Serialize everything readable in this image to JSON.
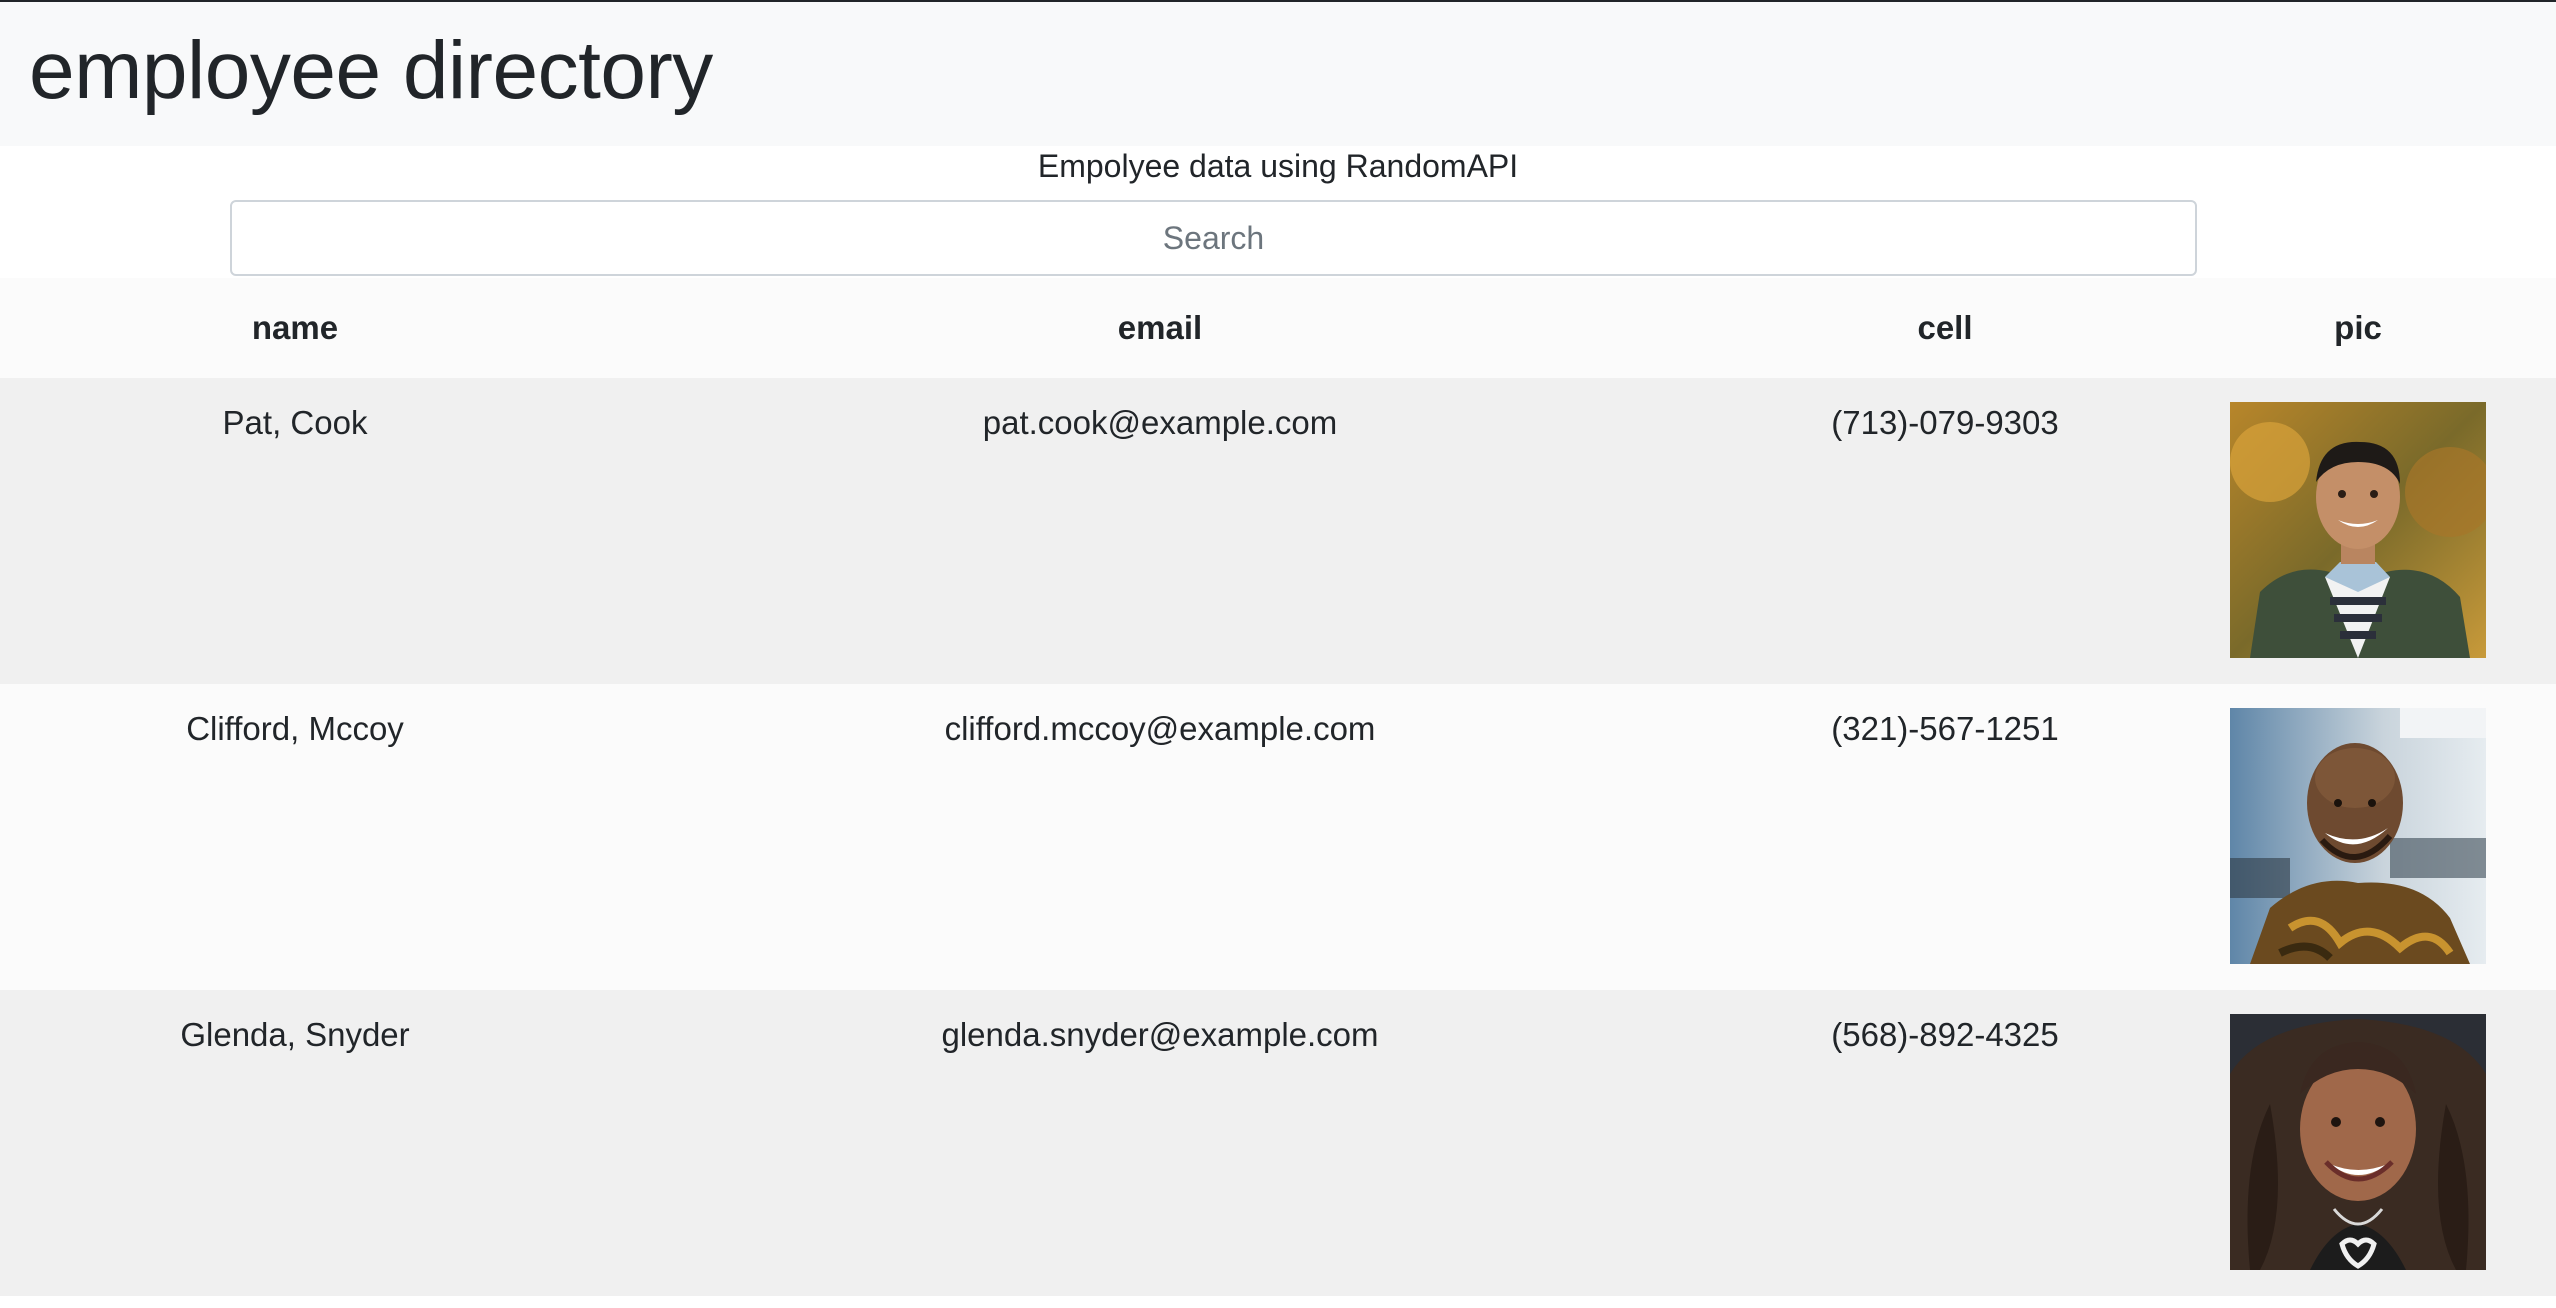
{
  "header": {
    "title": "employee directory"
  },
  "subtitle": "Empolyee data using RandomAPI",
  "search": {
    "placeholder": "Search",
    "value": ""
  },
  "table": {
    "columns": [
      "name",
      "email",
      "cell",
      "pic"
    ],
    "rows": [
      {
        "name": "Pat, Cook",
        "email": "pat.cook@example.com",
        "cell": "(713)-079-9303",
        "pic_icon": "employee-photo"
      },
      {
        "name": "Clifford, Mccoy",
        "email": "clifford.mccoy@example.com",
        "cell": "(321)-567-1251",
        "pic_icon": "employee-photo"
      },
      {
        "name": "Glenda, Snyder",
        "email": "glenda.snyder@example.com",
        "cell": "(568)-892-4325",
        "pic_icon": "employee-photo"
      }
    ]
  },
  "colors": {
    "navbar_bg": "#f8f9fa",
    "row_odd": "#f0f0f0",
    "row_even": "#fbfbfb",
    "text": "#212529"
  }
}
